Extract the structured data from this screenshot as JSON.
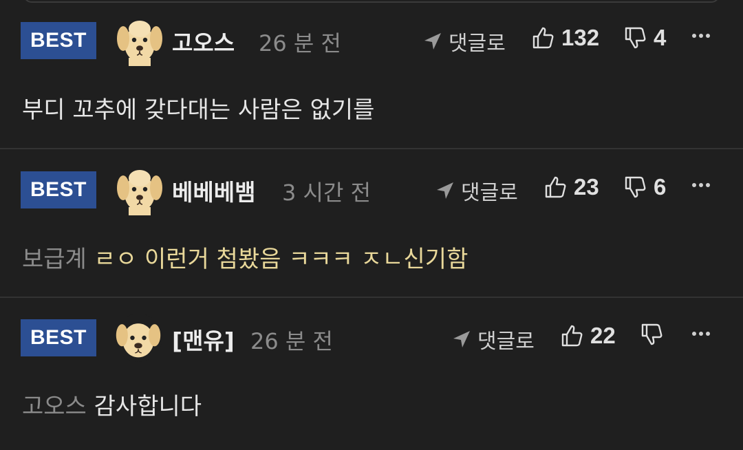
{
  "colors": {
    "background": "#1f1f1f",
    "badge": "#2c4f93",
    "meta_gray": "#8b8b8b",
    "highlight_yellow": "#e9d89a"
  },
  "comments": [
    {
      "badge": "BEST",
      "avatar_icon": "puppy-avatar-icon",
      "username": "고오스",
      "time": "26 분 전",
      "reply_label": "댓글로",
      "likes": "132",
      "dislikes": "4",
      "text": "부디 꼬추에 갖다대는 사람은 없기를"
    },
    {
      "badge": "BEST",
      "avatar_icon": "puppy-avatar-icon",
      "username": "베베베뱀",
      "time": "3 시간 전",
      "reply_label": "댓글로",
      "likes": "23",
      "dislikes": "6",
      "mention": "보급계",
      "text": "ㄹㅇ 이런거 첨봤음 ㅋㅋㅋ ㅈㄴ신기함"
    },
    {
      "badge": "BEST",
      "avatar_icon": "puppy-avatar-icon",
      "username": "[맨유]",
      "time": "26 분 전",
      "reply_label": "댓글로",
      "likes": "22",
      "dislikes": "",
      "mention": "고오스",
      "text": "감사합니다"
    }
  ]
}
